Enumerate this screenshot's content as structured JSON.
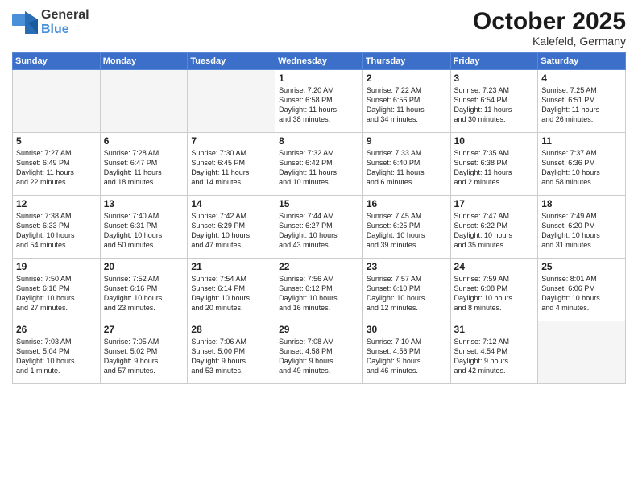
{
  "logo": {
    "general": "General",
    "blue": "Blue"
  },
  "title": "October 2025",
  "subtitle": "Kalefeld, Germany",
  "days_of_week": [
    "Sunday",
    "Monday",
    "Tuesday",
    "Wednesday",
    "Thursday",
    "Friday",
    "Saturday"
  ],
  "weeks": [
    [
      {
        "day": "",
        "info": ""
      },
      {
        "day": "",
        "info": ""
      },
      {
        "day": "",
        "info": ""
      },
      {
        "day": "1",
        "info": "Sunrise: 7:20 AM\nSunset: 6:58 PM\nDaylight: 11 hours\nand 38 minutes."
      },
      {
        "day": "2",
        "info": "Sunrise: 7:22 AM\nSunset: 6:56 PM\nDaylight: 11 hours\nand 34 minutes."
      },
      {
        "day": "3",
        "info": "Sunrise: 7:23 AM\nSunset: 6:54 PM\nDaylight: 11 hours\nand 30 minutes."
      },
      {
        "day": "4",
        "info": "Sunrise: 7:25 AM\nSunset: 6:51 PM\nDaylight: 11 hours\nand 26 minutes."
      }
    ],
    [
      {
        "day": "5",
        "info": "Sunrise: 7:27 AM\nSunset: 6:49 PM\nDaylight: 11 hours\nand 22 minutes."
      },
      {
        "day": "6",
        "info": "Sunrise: 7:28 AM\nSunset: 6:47 PM\nDaylight: 11 hours\nand 18 minutes."
      },
      {
        "day": "7",
        "info": "Sunrise: 7:30 AM\nSunset: 6:45 PM\nDaylight: 11 hours\nand 14 minutes."
      },
      {
        "day": "8",
        "info": "Sunrise: 7:32 AM\nSunset: 6:42 PM\nDaylight: 11 hours\nand 10 minutes."
      },
      {
        "day": "9",
        "info": "Sunrise: 7:33 AM\nSunset: 6:40 PM\nDaylight: 11 hours\nand 6 minutes."
      },
      {
        "day": "10",
        "info": "Sunrise: 7:35 AM\nSunset: 6:38 PM\nDaylight: 11 hours\nand 2 minutes."
      },
      {
        "day": "11",
        "info": "Sunrise: 7:37 AM\nSunset: 6:36 PM\nDaylight: 10 hours\nand 58 minutes."
      }
    ],
    [
      {
        "day": "12",
        "info": "Sunrise: 7:38 AM\nSunset: 6:33 PM\nDaylight: 10 hours\nand 54 minutes."
      },
      {
        "day": "13",
        "info": "Sunrise: 7:40 AM\nSunset: 6:31 PM\nDaylight: 10 hours\nand 50 minutes."
      },
      {
        "day": "14",
        "info": "Sunrise: 7:42 AM\nSunset: 6:29 PM\nDaylight: 10 hours\nand 47 minutes."
      },
      {
        "day": "15",
        "info": "Sunrise: 7:44 AM\nSunset: 6:27 PM\nDaylight: 10 hours\nand 43 minutes."
      },
      {
        "day": "16",
        "info": "Sunrise: 7:45 AM\nSunset: 6:25 PM\nDaylight: 10 hours\nand 39 minutes."
      },
      {
        "day": "17",
        "info": "Sunrise: 7:47 AM\nSunset: 6:22 PM\nDaylight: 10 hours\nand 35 minutes."
      },
      {
        "day": "18",
        "info": "Sunrise: 7:49 AM\nSunset: 6:20 PM\nDaylight: 10 hours\nand 31 minutes."
      }
    ],
    [
      {
        "day": "19",
        "info": "Sunrise: 7:50 AM\nSunset: 6:18 PM\nDaylight: 10 hours\nand 27 minutes."
      },
      {
        "day": "20",
        "info": "Sunrise: 7:52 AM\nSunset: 6:16 PM\nDaylight: 10 hours\nand 23 minutes."
      },
      {
        "day": "21",
        "info": "Sunrise: 7:54 AM\nSunset: 6:14 PM\nDaylight: 10 hours\nand 20 minutes."
      },
      {
        "day": "22",
        "info": "Sunrise: 7:56 AM\nSunset: 6:12 PM\nDaylight: 10 hours\nand 16 minutes."
      },
      {
        "day": "23",
        "info": "Sunrise: 7:57 AM\nSunset: 6:10 PM\nDaylight: 10 hours\nand 12 minutes."
      },
      {
        "day": "24",
        "info": "Sunrise: 7:59 AM\nSunset: 6:08 PM\nDaylight: 10 hours\nand 8 minutes."
      },
      {
        "day": "25",
        "info": "Sunrise: 8:01 AM\nSunset: 6:06 PM\nDaylight: 10 hours\nand 4 minutes."
      }
    ],
    [
      {
        "day": "26",
        "info": "Sunrise: 7:03 AM\nSunset: 5:04 PM\nDaylight: 10 hours\nand 1 minute."
      },
      {
        "day": "27",
        "info": "Sunrise: 7:05 AM\nSunset: 5:02 PM\nDaylight: 9 hours\nand 57 minutes."
      },
      {
        "day": "28",
        "info": "Sunrise: 7:06 AM\nSunset: 5:00 PM\nDaylight: 9 hours\nand 53 minutes."
      },
      {
        "day": "29",
        "info": "Sunrise: 7:08 AM\nSunset: 4:58 PM\nDaylight: 9 hours\nand 49 minutes."
      },
      {
        "day": "30",
        "info": "Sunrise: 7:10 AM\nSunset: 4:56 PM\nDaylight: 9 hours\nand 46 minutes."
      },
      {
        "day": "31",
        "info": "Sunrise: 7:12 AM\nSunset: 4:54 PM\nDaylight: 9 hours\nand 42 minutes."
      },
      {
        "day": "",
        "info": ""
      }
    ]
  ]
}
